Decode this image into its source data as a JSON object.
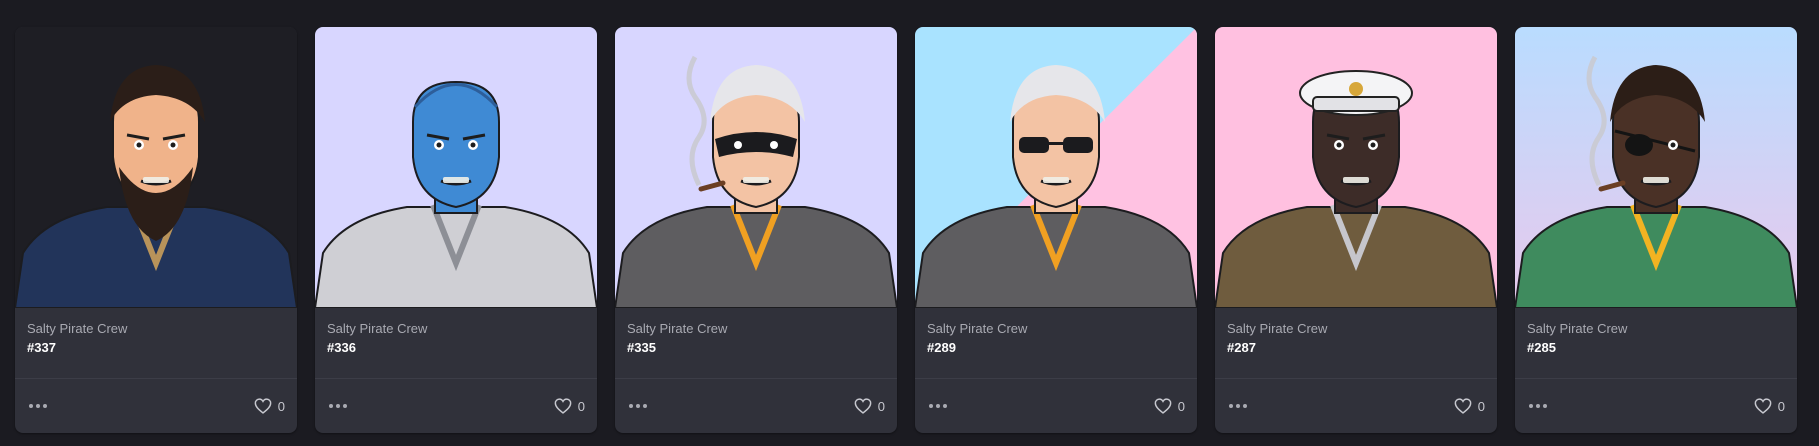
{
  "cards": [
    {
      "collection": "Salty Pirate Crew",
      "token": "#337",
      "likes": "0",
      "bg": "#1e1e24",
      "bg2": "#1e1e24",
      "skin": "#f0b38a",
      "hair": "#2b1e18",
      "outfit": "#22345a",
      "accent": "#b8935a",
      "headwear": "none",
      "eyewear": "none",
      "smoke": false
    },
    {
      "collection": "Salty Pirate Crew",
      "token": "#336",
      "likes": "0",
      "bg": "#d8d6ff",
      "bg2": "#d8d6ff",
      "skin": "#3f8ad4",
      "hair": "#2d5e9a",
      "outfit": "#cfcfd4",
      "accent": "#8d8f96",
      "headwear": "bald",
      "eyewear": "none",
      "smoke": false
    },
    {
      "collection": "Salty Pirate Crew",
      "token": "#335",
      "likes": "0",
      "bg": "#d8d6ff",
      "bg2": "#d8d6ff",
      "skin": "#f3c3a4",
      "hair": "#e6e6ea",
      "outfit": "#5e5d60",
      "accent": "#f0a022",
      "headwear": "none",
      "eyewear": "mask",
      "smoke": true
    },
    {
      "collection": "Salty Pirate Crew",
      "token": "#289",
      "likes": "0",
      "bg": "#a9e3ff",
      "bg2": "#ffc2e2",
      "skin": "#f3c3a4",
      "hair": "#e6e6ea",
      "outfit": "#5e5d60",
      "accent": "#f0a022",
      "headwear": "none",
      "eyewear": "shades",
      "smoke": false
    },
    {
      "collection": "Salty Pirate Crew",
      "token": "#287",
      "likes": "0",
      "bg": "#ffc0e0",
      "bg2": "#ffc0e0",
      "skin": "#3d2c28",
      "hair": "#1a1414",
      "outfit": "#6f5c3e",
      "accent": "#c6c6cc",
      "headwear": "captain",
      "eyewear": "none",
      "smoke": false
    },
    {
      "collection": "Salty Pirate Crew",
      "token": "#285",
      "likes": "0",
      "bg": "#b9dcff",
      "bg2": "#e8c9ec",
      "skin": "#4a3126",
      "hair": "#2c1e17",
      "outfit": "#3f8b5e",
      "accent": "#f2b322",
      "headwear": "none",
      "eyewear": "patch",
      "smoke": true
    }
  ]
}
